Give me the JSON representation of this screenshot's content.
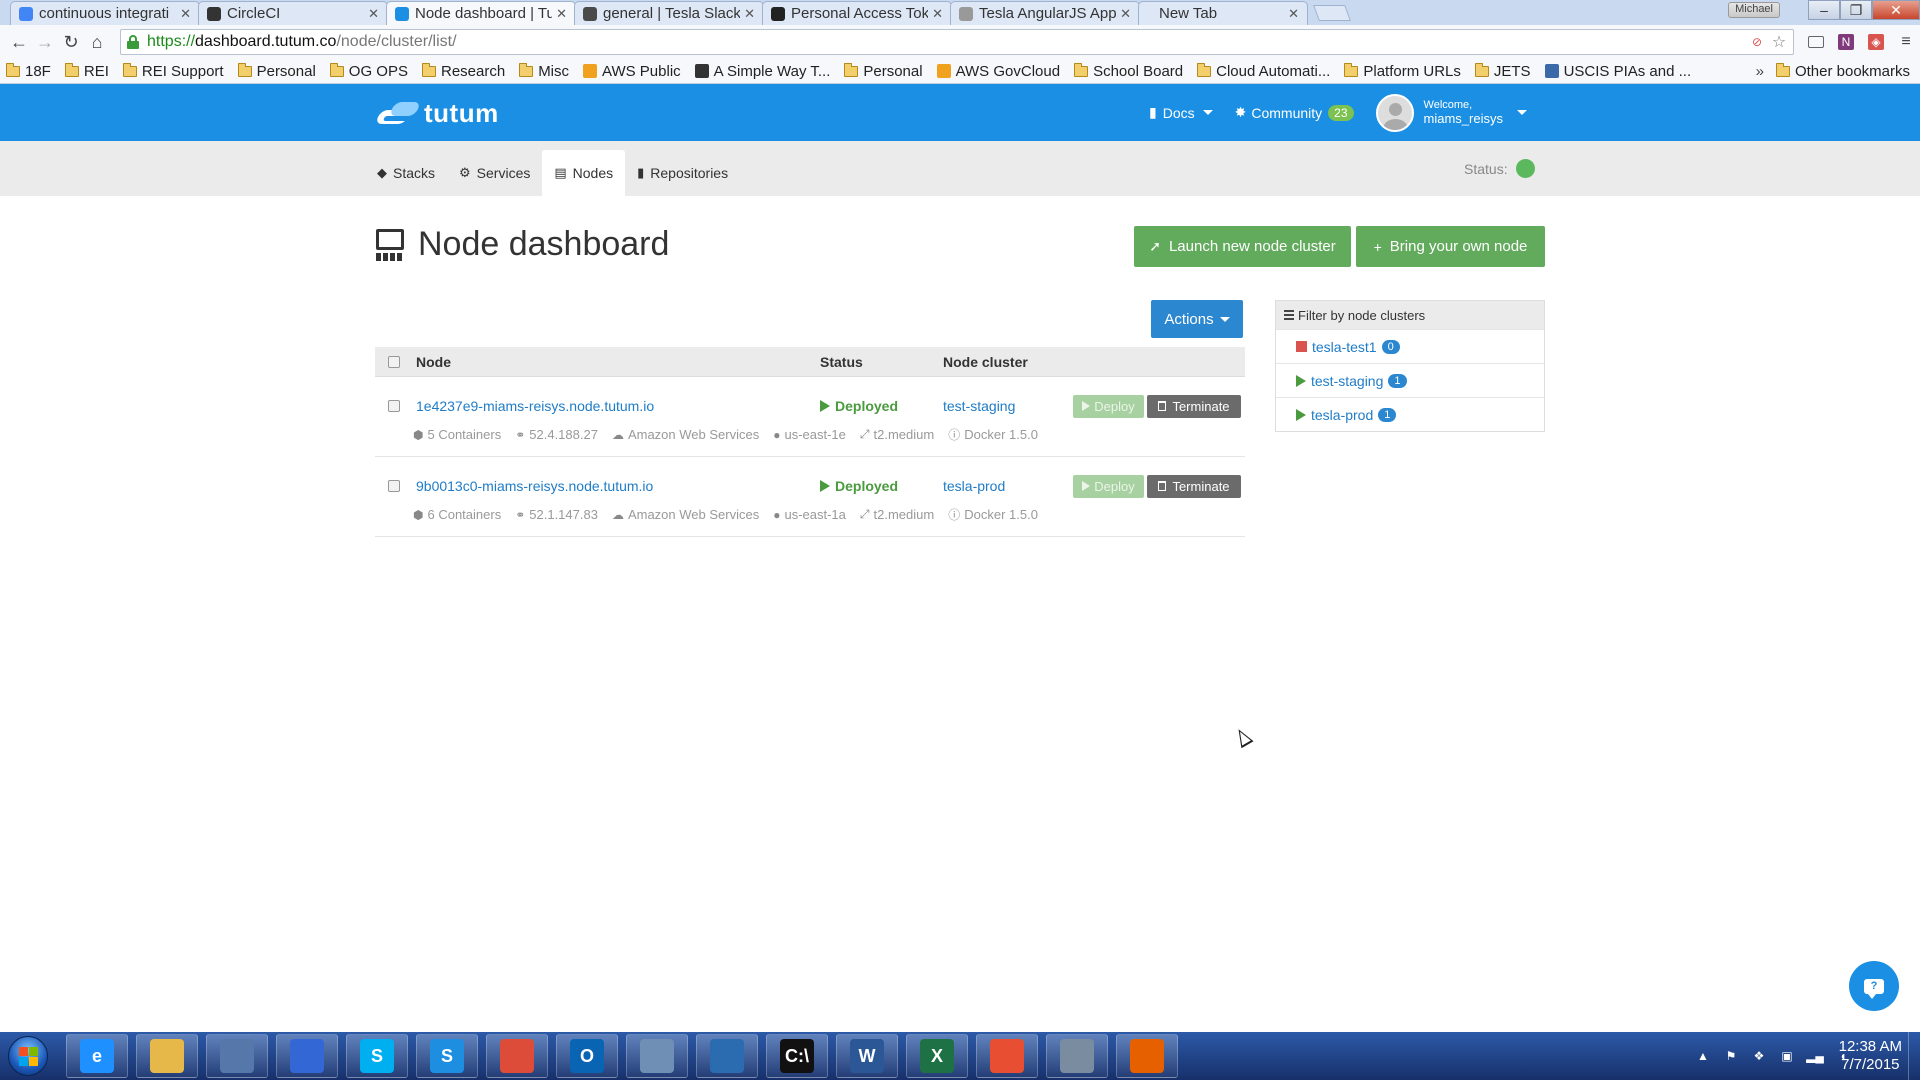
{
  "browser": {
    "tabs": [
      {
        "title": "continuous integrati",
        "icon": "google-icon",
        "color": "#4285f4",
        "active": false
      },
      {
        "title": "CircleCI",
        "icon": "circleci-icon",
        "color": "#333333",
        "active": false
      },
      {
        "title": "Node dashboard | Tu",
        "icon": "tutum-icon",
        "color": "#1a8fe3",
        "active": true
      },
      {
        "title": "general | Tesla Slack",
        "icon": "slack-icon",
        "color": "#4a4a4a",
        "active": false
      },
      {
        "title": "Personal Access Toke",
        "icon": "github-icon",
        "color": "#222222",
        "active": false
      },
      {
        "title": "Tesla AngularJS App",
        "icon": "page-icon",
        "color": "#999999",
        "active": false
      },
      {
        "title": "New Tab",
        "icon": "",
        "color": "",
        "active": false
      }
    ],
    "window_user": "Michael",
    "url_scheme": "https://",
    "url_host": "dashboard.tutum.co",
    "url_path": "/node/cluster/list/",
    "bookmarks": [
      {
        "label": "18F",
        "type": "folder"
      },
      {
        "label": "REI",
        "type": "folder"
      },
      {
        "label": "REI Support",
        "type": "folder"
      },
      {
        "label": "Personal",
        "type": "folder"
      },
      {
        "label": "OG OPS",
        "type": "folder"
      },
      {
        "label": "Research",
        "type": "folder"
      },
      {
        "label": "Misc",
        "type": "folder"
      },
      {
        "label": "AWS Public",
        "type": "aws"
      },
      {
        "label": "A Simple Way T...",
        "type": "page"
      },
      {
        "label": "Personal",
        "type": "folder"
      },
      {
        "label": "AWS GovCloud",
        "type": "aws"
      },
      {
        "label": "School Board",
        "type": "folder"
      },
      {
        "label": "Cloud Automati...",
        "type": "folder"
      },
      {
        "label": "Platform URLs",
        "type": "folder"
      },
      {
        "label": "JETS",
        "type": "folder"
      },
      {
        "label": "USCIS PIAs and ...",
        "type": "uscis"
      }
    ],
    "bookmarks_more": "»",
    "other_bookmarks": "Other bookmarks"
  },
  "header": {
    "logo": "tutum",
    "docs_label": "Docs",
    "community_label": "Community",
    "community_count": "23",
    "welcome_label": "Welcome,",
    "username": "miams_reisys"
  },
  "subnav": {
    "tabs": [
      {
        "label": "Stacks",
        "icon": "stacks-icon",
        "active": false
      },
      {
        "label": "Services",
        "icon": "services-icon",
        "active": false
      },
      {
        "label": "Nodes",
        "icon": "nodes-icon",
        "active": true
      },
      {
        "label": "Repositories",
        "icon": "repositories-icon",
        "active": false
      }
    ],
    "status_label": "Status:",
    "status_color": "#5cb85c"
  },
  "page": {
    "title": "Node dashboard",
    "launch_label": "Launch new node cluster",
    "byon_label": "Bring your own node",
    "actions_label": "Actions"
  },
  "table": {
    "headers": {
      "node": "Node",
      "status": "Status",
      "cluster": "Node cluster"
    },
    "deploy_label": "Deploy",
    "terminate_label": "Terminate",
    "rows": [
      {
        "node": "1e4237e9-miams-reisys.node.tutum.io",
        "status": "Deployed",
        "cluster": "test-staging",
        "containers": "5 Containers",
        "ip": "52.4.188.27",
        "provider": "Amazon Web Services",
        "region": "us-east-1e",
        "size": "t2.medium",
        "docker": "Docker 1.5.0"
      },
      {
        "node": "9b0013c0-miams-reisys.node.tutum.io",
        "status": "Deployed",
        "cluster": "tesla-prod",
        "containers": "6 Containers",
        "ip": "52.1.147.83",
        "provider": "Amazon Web Services",
        "region": "us-east-1a",
        "size": "t2.medium",
        "docker": "Docker 1.5.0"
      }
    ]
  },
  "filter": {
    "title": "Filter by node clusters",
    "items": [
      {
        "label": "tesla-test1",
        "count": "0",
        "state": "stopped"
      },
      {
        "label": "test-staging",
        "count": "1",
        "state": "deployed"
      },
      {
        "label": "tesla-prod",
        "count": "1",
        "state": "deployed"
      }
    ]
  },
  "taskbar": {
    "apps": [
      {
        "name": "ie",
        "label": "e",
        "color": "#1e90ff"
      },
      {
        "name": "explorer",
        "label": "",
        "color": "#e6b84a"
      },
      {
        "name": "network",
        "label": "",
        "color": "#5577aa"
      },
      {
        "name": "apps-grid",
        "label": "",
        "color": "#3367d6"
      },
      {
        "name": "skype",
        "label": "S",
        "color": "#00aff0"
      },
      {
        "name": "lync",
        "label": "S",
        "color": "#1e8ee0"
      },
      {
        "name": "chrome",
        "label": "",
        "color": "#dd4b39"
      },
      {
        "name": "outlook",
        "label": "O",
        "color": "#0a64b4"
      },
      {
        "name": "paint",
        "label": "",
        "color": "#6f8fb4"
      },
      {
        "name": "sourcetree",
        "label": "",
        "color": "#2b6cb0"
      },
      {
        "name": "cmd",
        "label": "C:\\",
        "color": "#111111"
      },
      {
        "name": "word",
        "label": "W",
        "color": "#2b5797"
      },
      {
        "name": "excel",
        "label": "X",
        "color": "#1e7145"
      },
      {
        "name": "git",
        "label": "",
        "color": "#e84e31"
      },
      {
        "name": "virtualbox",
        "label": "",
        "color": "#7a8ca0"
      },
      {
        "name": "firefox",
        "label": "",
        "color": "#e66000"
      }
    ],
    "time": "12:38 AM",
    "date": "7/7/2015"
  }
}
